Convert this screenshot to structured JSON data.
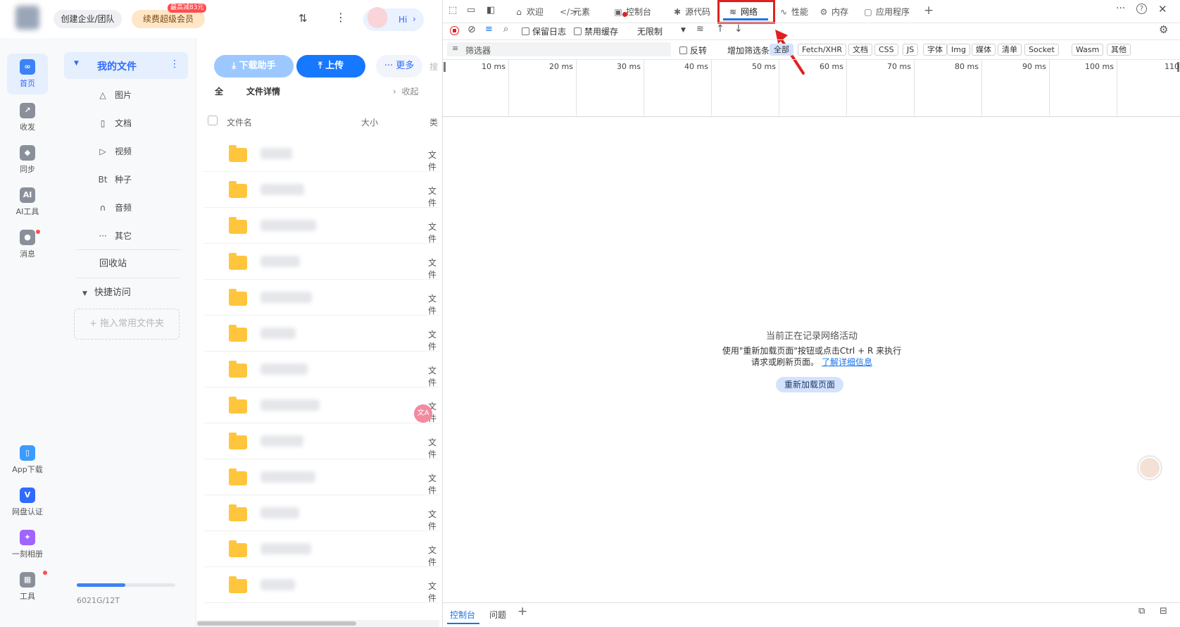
{
  "topbar": {
    "create_team": "创建企业/团队",
    "renew_vip": "续费超级会员",
    "promo_badge": "最高减83元",
    "hi": "Hi"
  },
  "rail": {
    "items": [
      {
        "label": "首页",
        "icon": "home-icon"
      },
      {
        "label": "收发",
        "icon": "share-icon"
      },
      {
        "label": "同步",
        "icon": "sync-icon"
      },
      {
        "label": "AI工具",
        "icon": "ai-icon"
      },
      {
        "label": "消息",
        "icon": "message-icon"
      }
    ],
    "bottom_items": [
      {
        "label": "App下载",
        "icon": "phone-icon"
      },
      {
        "label": "网盘认证",
        "icon": "verify-icon"
      },
      {
        "label": "一刻相册",
        "icon": "album-icon"
      },
      {
        "label": "工具",
        "icon": "tools-icon"
      }
    ]
  },
  "tree": {
    "my_files": "我的文件",
    "categories": [
      {
        "label": "图片",
        "icon": "image-icon"
      },
      {
        "label": "文档",
        "icon": "doc-icon"
      },
      {
        "label": "视频",
        "icon": "video-icon"
      },
      {
        "label": "种子",
        "icon": "bt-icon",
        "glyph": "Bt"
      },
      {
        "label": "音频",
        "icon": "audio-icon"
      },
      {
        "label": "其它",
        "icon": "other-icon"
      }
    ],
    "recycle": "回收站",
    "quick_access": "快捷访问",
    "drop_hint": "+ 拖入常用文件夹",
    "storage": "6021G/12T",
    "storage_fraction": 0.49
  },
  "files": {
    "download_helper": "下载助手",
    "upload": "上传",
    "more": "更多",
    "search": "搜",
    "breadcrumb_all": "全",
    "details": "文件详情",
    "collapse": "收起",
    "col_name": "文件名",
    "col_size": "大小",
    "col_type": "类",
    "row_type": "文件",
    "row_count": 13
  },
  "devtools": {
    "tabs": [
      {
        "label": "欢迎",
        "icon": "home-outline-icon"
      },
      {
        "label": "元素",
        "icon": "code-icon"
      },
      {
        "label": "控制台",
        "icon": "console-icon"
      },
      {
        "label": "源代码",
        "icon": "bug-icon"
      },
      {
        "label": "网络",
        "icon": "wifi-icon",
        "active": true
      },
      {
        "label": "性能",
        "icon": "performance-icon"
      },
      {
        "label": "内存",
        "icon": "memory-icon"
      },
      {
        "label": "应用程序",
        "icon": "application-icon"
      }
    ],
    "toolbar": {
      "preserve_log": "保留日志",
      "disable_cache": "禁用缓存",
      "throttle": "无限制"
    },
    "filter": {
      "placeholder": "筛选器",
      "invert": "反转",
      "more_filters": "增加筛选条件",
      "types": [
        "全部",
        "Fetch/XHR",
        "文档",
        "CSS",
        "JS",
        "字体",
        "Img",
        "媒体",
        "清单",
        "Socket",
        "Wasm",
        "其他"
      ]
    },
    "timeline_ticks": [
      "10 ms",
      "20 ms",
      "30 ms",
      "40 ms",
      "50 ms",
      "60 ms",
      "70 ms",
      "80 ms",
      "90 ms",
      "100 ms",
      "110"
    ],
    "empty": {
      "line1": "当前正在记录网络活动",
      "line2": "使用\"重新加载页面\"按钮或点击Ctrl + R 来执行",
      "line3": "请求或刷新页面。",
      "learn_more": "了解详细信息",
      "reload": "重新加载页面"
    },
    "drawer_tabs": [
      "控制台",
      "问题"
    ],
    "accent": "#1a73e8",
    "highlight": "#e02020"
  }
}
